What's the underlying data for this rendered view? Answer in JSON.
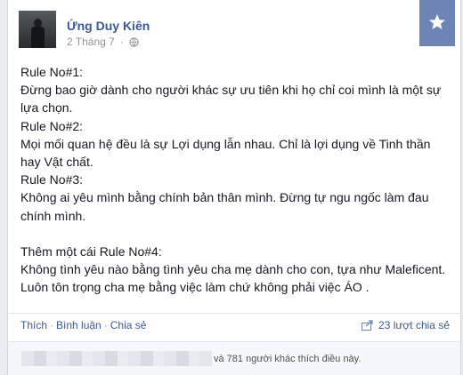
{
  "post": {
    "author": "Ứng Duy Kiên",
    "date": "2 Tháng 7",
    "privacy_icon": "globe-icon",
    "bookmark_icon": "star-icon",
    "lines": [
      "Rule No#1:",
      "Đừng bao giờ dành cho người khác sự ưu tiên khi họ chỉ coi mình là một sự",
      "lựa chọn.",
      "Rule No#2:",
      "Mọi mối quan hệ đều là sự Lợi dụng lẫn nhau. Chỉ là lợi dụng về Tinh thần",
      "hay Vật chất.",
      "Rule No#3:",
      "Không ai yêu mình bằng chính bản thân mình. Đừng tự ngu ngốc làm đau",
      "chính mình.",
      "",
      "Thêm một cái Rule No#4:",
      "Không tình yêu nào bằng tình yêu cha mẹ dành cho con, tựa như Maleficent.",
      "Luôn tôn trọng cha mẹ bằng việc làm chứ không phải việc ÁO ."
    ]
  },
  "actions": {
    "like": "Thích",
    "comment": "Bình luận",
    "share": "Chia sẻ",
    "separator": "·"
  },
  "shares": {
    "count_label": "23 lượt chia sẻ",
    "icon": "share-icon"
  },
  "likes": {
    "text": "và 781 người khác thích điều này."
  },
  "colors": {
    "link": "#3b5998",
    "bookmark": "#6d84b4",
    "muted": "#90949c"
  }
}
